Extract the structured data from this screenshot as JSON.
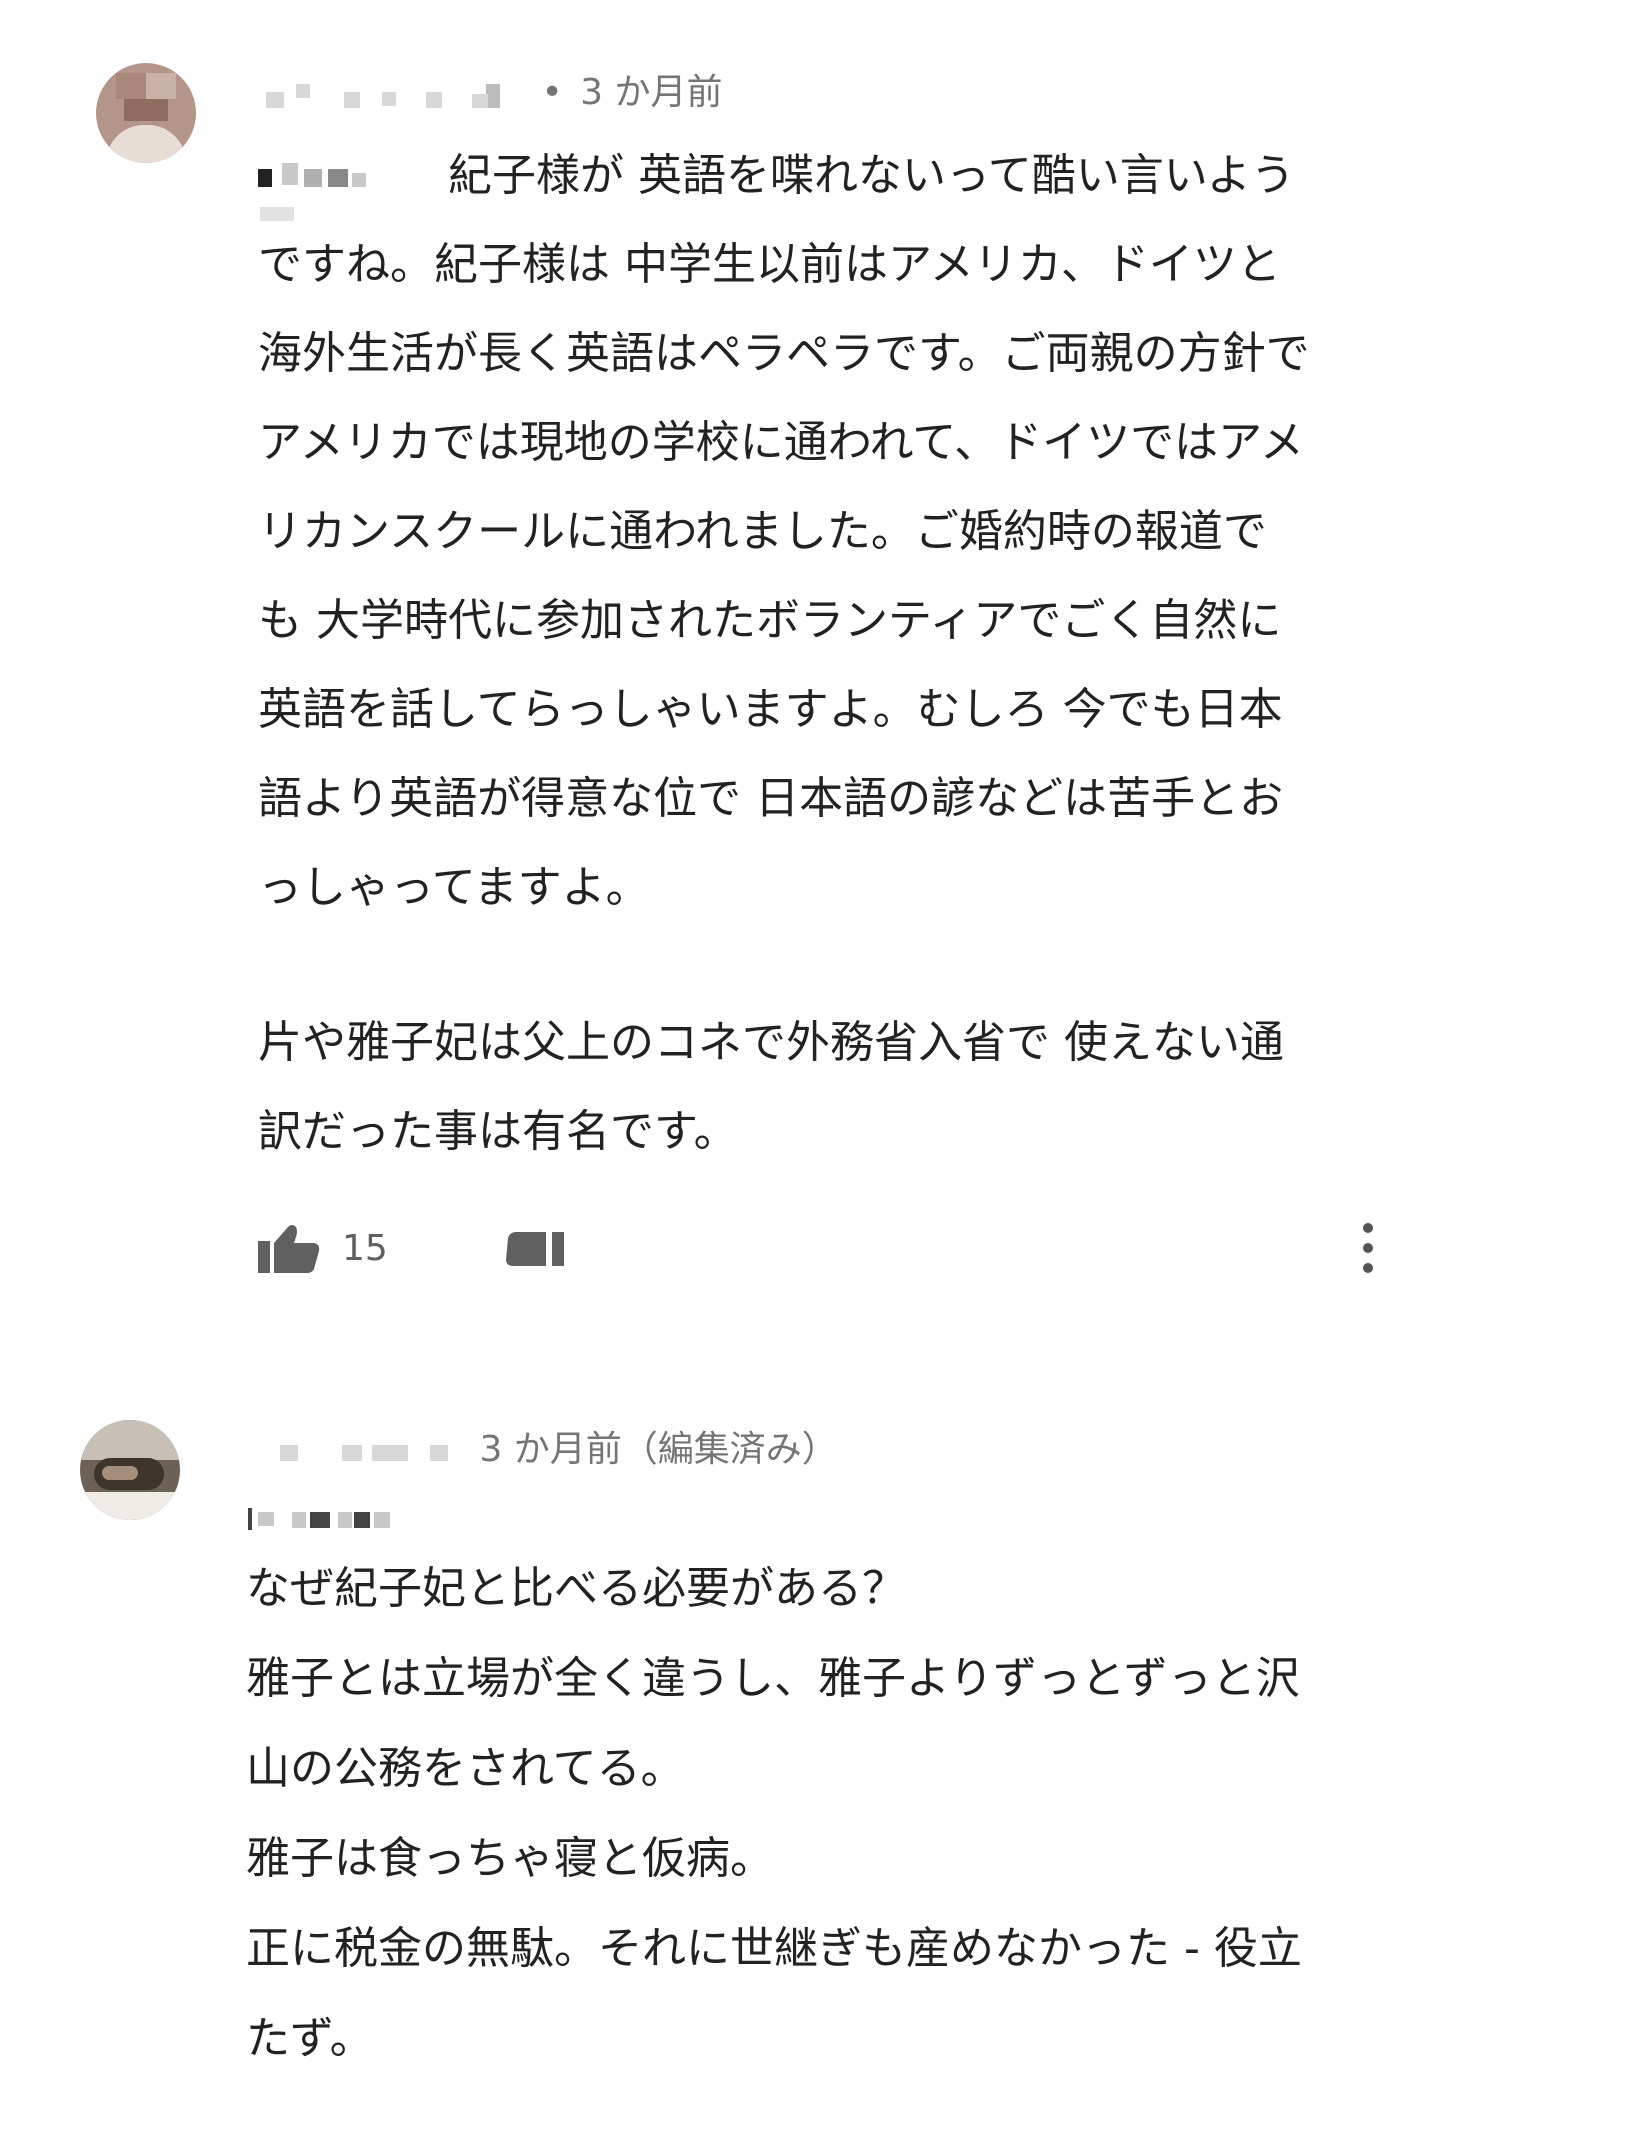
{
  "comments": [
    {
      "timestamp": "3 か月前",
      "text_lines": [
        "紀子様が 英語を喋れないって酷い言いよう",
        "ですね。紀子様は 中学生以前はアメリカ、ドイツと",
        "海外生活が長く英語はペラペラです。ご両親の方針で",
        "アメリカでは現地の学校に通われて、ドイツではアメ",
        "リカンスクールに通われました。ご婚約時の報道で",
        "も 大学時代に参加されたボランティアでごく自然に",
        "英語を話してらっしゃいますよ。むしろ 今でも日本",
        "語より英語が得意な位で 日本語の諺などは苦手とお",
        "っしゃってますよ。",
        "片や雅子妃は父上のコネで外務省入省で 使えない通",
        "訳だった事は有名です。"
      ],
      "like_count": "15",
      "icons": {
        "like": "thumbs-up-icon",
        "dislike": "thumbs-down-icon",
        "more": "more-vertical-icon"
      }
    },
    {
      "timestamp": "3 か月前（編集済み）",
      "text_lines": [
        "なぜ紀子妃と比べる必要がある？",
        "雅子とは立場が全く違うし、雅子よりずっとずっと沢",
        "山の公務をされてる。",
        "雅子は食っちゃ寝と仮病。",
        "正に税金の無駄。それに世継ぎも産めなかった - 役立",
        "たず。"
      ]
    }
  ],
  "colors": {
    "text": "#222222",
    "meta": "#757575",
    "icon": "#606060"
  }
}
